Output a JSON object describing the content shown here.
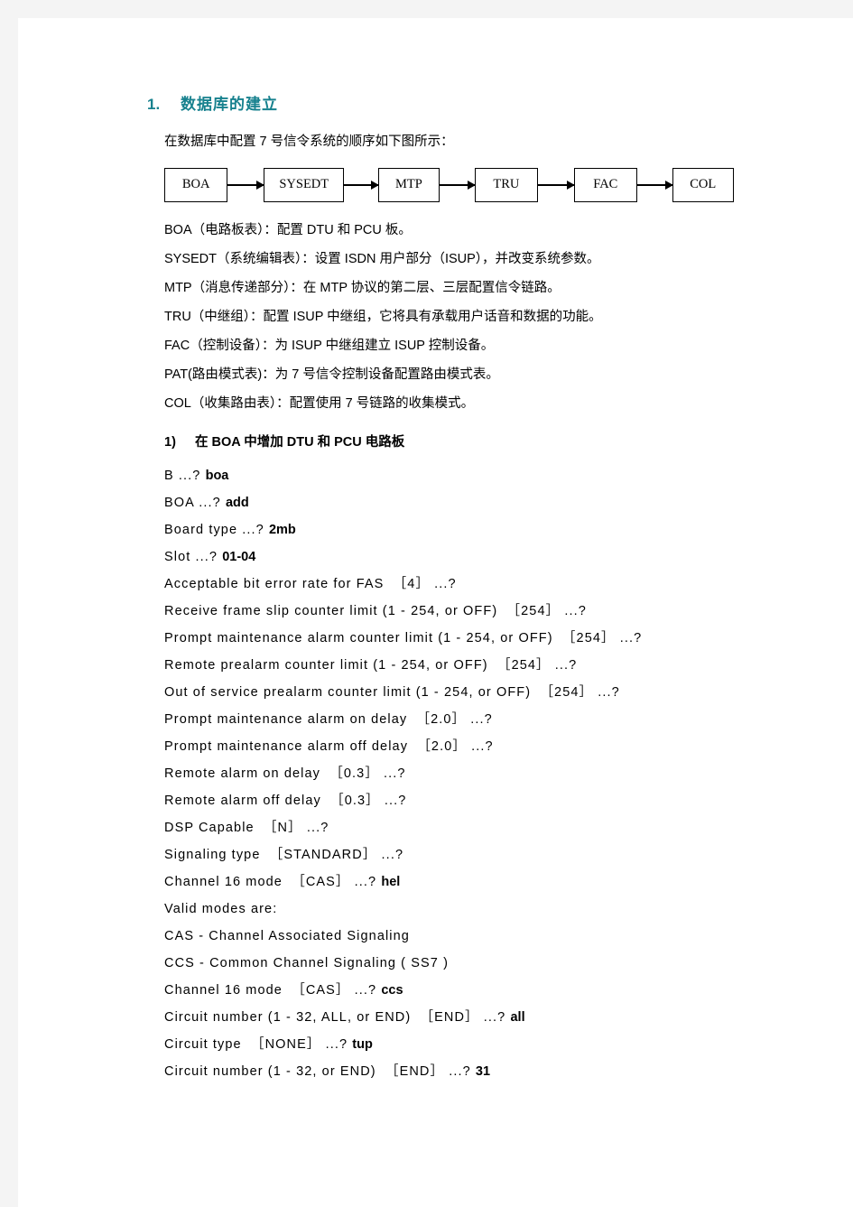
{
  "page": {
    "background_color": "#f4f4f4",
    "paper_color": "#ffffff"
  },
  "heading": {
    "number": "1.",
    "title": "数据库的建立",
    "color": "#17818e"
  },
  "intro": "在数据库中配置 7 号信令系统的顺序如下图所示：",
  "diagram": {
    "type": "flow",
    "boxes": [
      "BOA",
      "SYSEDT",
      "MTP",
      "TRU",
      "FAC",
      "COL"
    ]
  },
  "descriptions": [
    "BOA（电路板表）：配置 DTU 和 PCU 板。",
    "SYSEDT（系统编辑表）：设置 ISDN 用户部分（ISUP），并改变系统参数。",
    "MTP（消息传递部分）：在 MTP 协议的第二层、三层配置信令链路。",
    "TRU（中继组）：配置 ISUP 中继组，它将具有承载用户话音和数据的功能。",
    "FAC（控制设备）：为 ISUP 中继组建立 ISUP 控制设备。",
    "PAT(路由模式表)：为 7 号信令控制设备配置路由模式表。",
    "COL（收集路由表）：配置使用 7 号链路的收集模式。"
  ],
  "subheading": {
    "number": "1)",
    "title": "在 BOA 中增加 DTU 和 PCU 电路板"
  },
  "cli_lines": [
    {
      "prompt": "B ...? ",
      "answer": "boa"
    },
    {
      "prompt": "BOA ...? ",
      "answer": "add"
    },
    {
      "prompt": "Board type ...? ",
      "answer": "2mb"
    },
    {
      "prompt": "Slot ...? ",
      "answer": "01-04"
    },
    {
      "prompt": "Acceptable bit error rate for FAS  ［4］ ...?",
      "answer": ""
    },
    {
      "prompt": "Receive frame slip counter limit (1 - 254, or OFF)  ［254］ ...?",
      "answer": ""
    },
    {
      "prompt": "Prompt maintenance alarm counter limit (1 - 254, or OFF)  ［254］ ...?",
      "answer": ""
    },
    {
      "prompt": "Remote prealarm counter limit (1 - 254, or OFF)  ［254］ ...?",
      "answer": ""
    },
    {
      "prompt": "Out of service prealarm counter limit (1 - 254, or OFF)  ［254］ ...?",
      "answer": ""
    },
    {
      "prompt": "Prompt maintenance alarm on delay  ［2.0］ ...?",
      "answer": ""
    },
    {
      "prompt": "Prompt maintenance alarm off delay  ［2.0］ ...?",
      "answer": ""
    },
    {
      "prompt": "Remote alarm on delay  ［0.3］ ...?",
      "answer": ""
    },
    {
      "prompt": "Remote alarm off delay  ［0.3］ ...?",
      "answer": ""
    },
    {
      "prompt": "DSP Capable  ［N］ ...?",
      "answer": ""
    },
    {
      "prompt": "Signaling type  ［STANDARD］ ...?",
      "answer": ""
    },
    {
      "prompt": "Channel 16 mode  ［CAS］ ...? ",
      "answer": "hel"
    },
    {
      "prompt": "Valid modes are:",
      "answer": ""
    },
    {
      "prompt": "CAS - Channel Associated Signaling",
      "answer": ""
    },
    {
      "prompt": "CCS - Common Channel Signaling ( SS7 )",
      "answer": ""
    },
    {
      "prompt": "Channel 16 mode  ［CAS］ ...? ",
      "answer": "ccs"
    },
    {
      "prompt": "Circuit number (1 - 32, ALL, or END)  ［END］ ...? ",
      "answer": "all"
    },
    {
      "prompt": "Circuit type  ［NONE］ ...? ",
      "answer": "tup"
    },
    {
      "prompt": "Circuit number (1 - 32, or END)  ［END］ ...? ",
      "answer": "31"
    }
  ]
}
